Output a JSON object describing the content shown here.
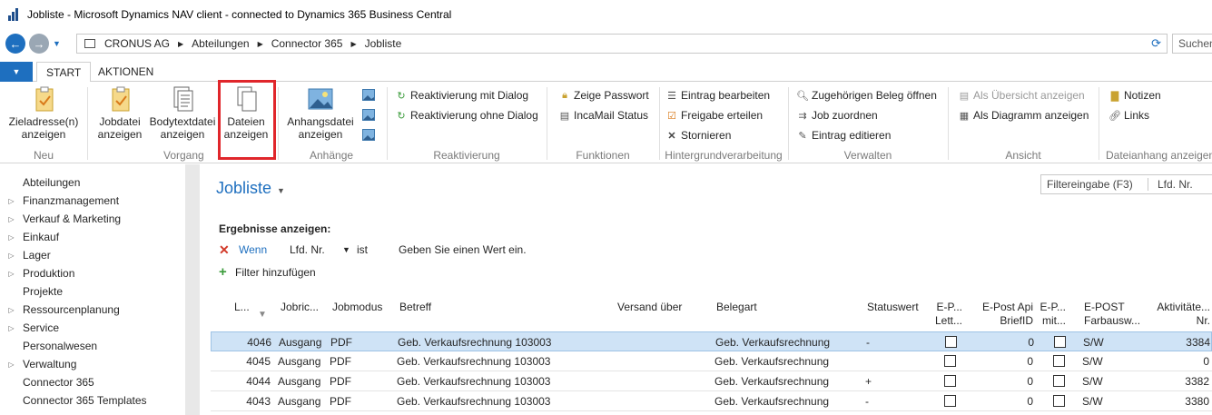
{
  "window": {
    "title": "Jobliste - Microsoft Dynamics NAV client - connected to Dynamics 365 Business Central"
  },
  "nav": {
    "breadcrumb": [
      "CRONUS AG",
      "Abteilungen",
      "Connector 365",
      "Jobliste"
    ],
    "search_placeholder": "Suchen"
  },
  "tabs": {
    "menu_arrow": "▼",
    "start": "START",
    "aktionen": "AKTIONEN"
  },
  "ribbon": {
    "neu": {
      "label": "Neu",
      "zieladresse": [
        "Zieladresse(n)",
        "anzeigen"
      ]
    },
    "vorgang": {
      "label": "Vorgang",
      "jobdatei": [
        "Jobdatei",
        "anzeigen"
      ],
      "bodytext": [
        "Bodytextdatei",
        "anzeigen"
      ],
      "dateien": [
        "Dateien",
        "anzeigen"
      ]
    },
    "anhaenge": {
      "label": "Anhänge",
      "anhangsdatei": [
        "Anhangsdatei",
        "anzeigen"
      ]
    },
    "reaktivierung": {
      "label": "Reaktivierung",
      "mit_dialog": "Reaktivierung mit Dialog",
      "ohne_dialog": "Reaktivierung ohne Dialog"
    },
    "funktionen": {
      "label": "Funktionen",
      "passwort": "Zeige Passwort",
      "status": "IncaMail Status"
    },
    "hintergrund": {
      "label": "Hintergrundverarbeitung",
      "bearbeiten": "Eintrag bearbeiten",
      "freigabe": "Freigabe erteilen",
      "stornieren": "Stornieren"
    },
    "verwalten": {
      "label": "Verwalten",
      "beleg": "Zugehörigen Beleg öffnen",
      "zuordnen": "Job zuordnen",
      "editieren": "Eintrag editieren"
    },
    "ansicht": {
      "label": "Ansicht",
      "uebersicht": "Als Übersicht anzeigen",
      "diagramm": "Als Diagramm anzeigen"
    },
    "dateianhang": {
      "label": "Dateianhang anzeigen",
      "notizen": "Notizen",
      "links": "Links"
    }
  },
  "sidebar": {
    "items": [
      {
        "label": "Abteilungen",
        "arrow": ""
      },
      {
        "label": "Finanzmanagement",
        "arrow": "▷"
      },
      {
        "label": "Verkauf & Marketing",
        "arrow": "▷"
      },
      {
        "label": "Einkauf",
        "arrow": "▷"
      },
      {
        "label": "Lager",
        "arrow": "▷"
      },
      {
        "label": "Produktion",
        "arrow": "▷"
      },
      {
        "label": "Projekte",
        "arrow": ""
      },
      {
        "label": "Ressourcenplanung",
        "arrow": "▷"
      },
      {
        "label": "Service",
        "arrow": "▷"
      },
      {
        "label": "Personalwesen",
        "arrow": ""
      },
      {
        "label": "Verwaltung",
        "arrow": "▷"
      },
      {
        "label": "Connector 365",
        "arrow": ""
      },
      {
        "label": "Connector 365 Templates",
        "arrow": ""
      }
    ]
  },
  "page": {
    "title": "Jobliste",
    "filter_placeholder": "Filtereingabe (F3)",
    "filter_field": "Lfd. Nr.",
    "results_label": "Ergebnisse anzeigen:",
    "filter_if": "Wenn",
    "filter_field_name": "Lfd. Nr.",
    "filter_op": "ist",
    "filter_value_hint": "Geben Sie einen Wert ein.",
    "add_filter": "Filter hinzufügen"
  },
  "table": {
    "headers": [
      "L...",
      "Jobric...",
      "Jobmodus",
      "Betreff",
      "Versand über",
      "Belegart",
      "Statuswert",
      "E-P... Lett...",
      "E-Post Api BriefID",
      "E-P... mit...",
      "E-POST Farbausw...",
      "Aktivitäte... Nr."
    ],
    "rows": [
      {
        "nr": "4046",
        "richtung": "Ausgang",
        "modus": "PDF",
        "betreff": "Geb. Verkaufsrechnung 103003",
        "versand": "",
        "belegart": "Geb. Verkaufsrechnung",
        "status": "-",
        "briefid": "0",
        "farbe": "S/W",
        "akt": "3384",
        "selected": true
      },
      {
        "nr": "4045",
        "richtung": "Ausgang",
        "modus": "PDF",
        "betreff": "Geb. Verkaufsrechnung 103003",
        "versand": "",
        "belegart": "Geb. Verkaufsrechnung",
        "status": "",
        "briefid": "0",
        "farbe": "S/W",
        "akt": "0",
        "selected": false
      },
      {
        "nr": "4044",
        "richtung": "Ausgang",
        "modus": "PDF",
        "betreff": "Geb. Verkaufsrechnung 103003",
        "versand": "",
        "belegart": "Geb. Verkaufsrechnung",
        "status": "+",
        "briefid": "0",
        "farbe": "S/W",
        "akt": "3382",
        "selected": false
      },
      {
        "nr": "4043",
        "richtung": "Ausgang",
        "modus": "PDF",
        "betreff": "Geb. Verkaufsrechnung 103003",
        "versand": "",
        "belegart": "Geb. Verkaufsrechnung",
        "status": "-",
        "briefid": "0",
        "farbe": "S/W",
        "akt": "3380",
        "selected": false
      }
    ]
  },
  "colors": {
    "accent": "#1e6fbf",
    "highlight": "#e0262b",
    "selected_row": "#cfe3f6"
  }
}
